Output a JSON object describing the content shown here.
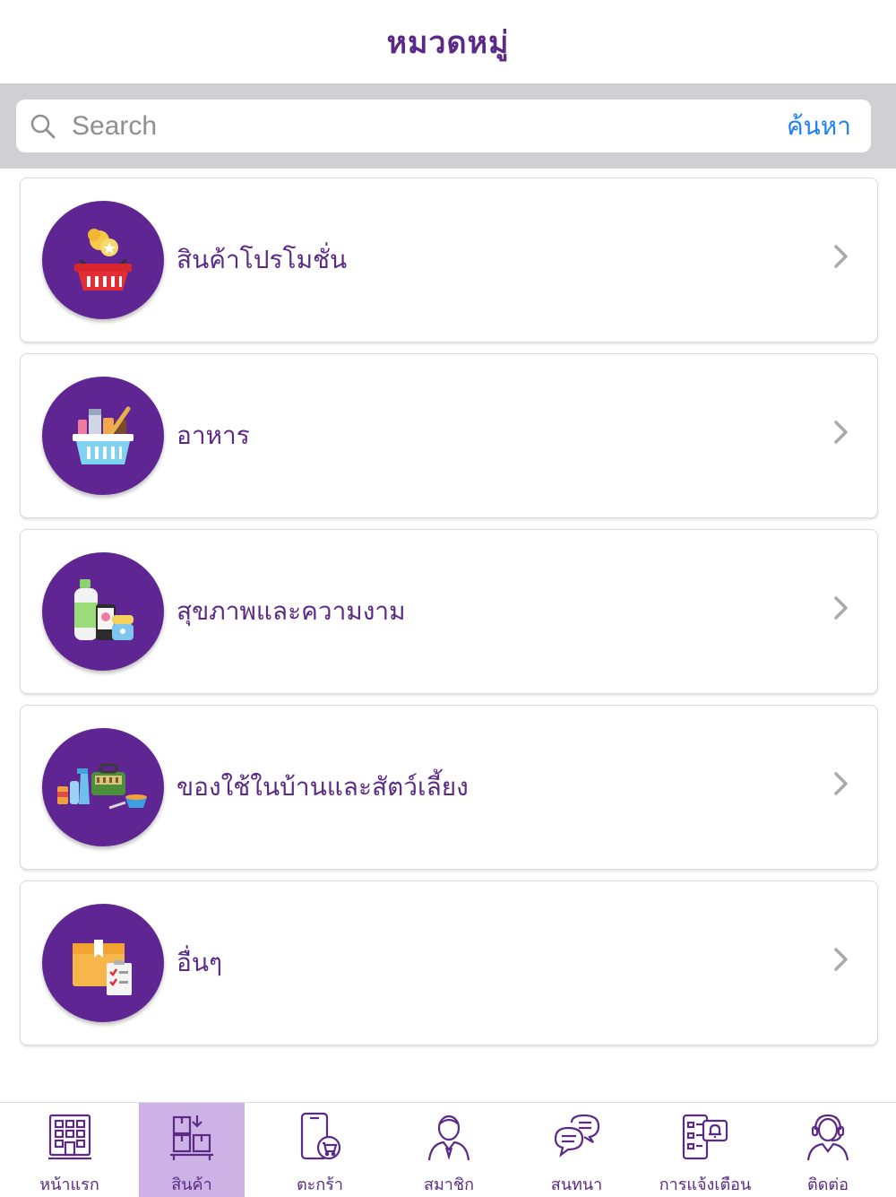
{
  "header": {
    "title": "หมวดหมู่"
  },
  "search": {
    "placeholder": "Search",
    "value": "",
    "button_label": "ค้นหา"
  },
  "categories": [
    {
      "label": "สินค้าโปรโมชั่น",
      "icon": "promotion-basket-icon"
    },
    {
      "label": "อาหาร",
      "icon": "food-basket-icon"
    },
    {
      "label": "สุขภาพและความงาม",
      "icon": "cosmetics-icon"
    },
    {
      "label": "ของใช้ในบ้านและสัตว์เลี้ยง",
      "icon": "household-pet-icon"
    },
    {
      "label": "อื่นๆ",
      "icon": "box-checklist-icon"
    }
  ],
  "tabs": [
    {
      "label": "หน้าแรก",
      "icon": "building-icon"
    },
    {
      "label": "สินค้า",
      "icon": "warehouse-boxes-icon",
      "active": true
    },
    {
      "label": "ตะกร้า",
      "icon": "phone-cart-icon"
    },
    {
      "label": "สมาชิก",
      "icon": "user-icon"
    },
    {
      "label": "สนทนา",
      "icon": "chat-bubbles-icon"
    },
    {
      "label": "การแจ้งเตือน",
      "icon": "notification-bell-icon"
    },
    {
      "label": "ติดต่อ",
      "icon": "support-agent-icon"
    }
  ],
  "colors": {
    "primary": "#5b2a86",
    "icon_circle": "#5f2592",
    "active_tab": "#cdb2e6",
    "link": "#1d7ff2"
  }
}
